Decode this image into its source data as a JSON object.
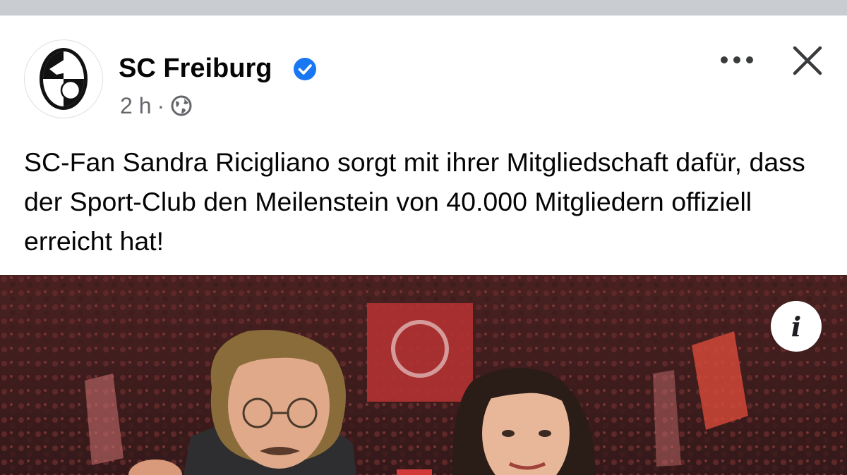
{
  "post": {
    "author": "SC Freiburg",
    "time": "2 h",
    "separator": "·",
    "caption": "SC-Fan Sandra Ricigliano sorgt mit ihrer Mitgliedschaft dafür, dass der Sport-Club den Meilenstein von 40.000 Mitgliedern offiziell erreicht hat!",
    "icons": {
      "verified": "verified-badge-icon",
      "audience": "globe-icon",
      "more": "more-options-icon",
      "close": "close-icon",
      "info": "info-icon"
    },
    "info_label": "i"
  },
  "colors": {
    "verified_blue": "#1877f2",
    "secondary_text": "#65676b",
    "primary_text": "#050505",
    "divider": "#c9ccd1"
  }
}
